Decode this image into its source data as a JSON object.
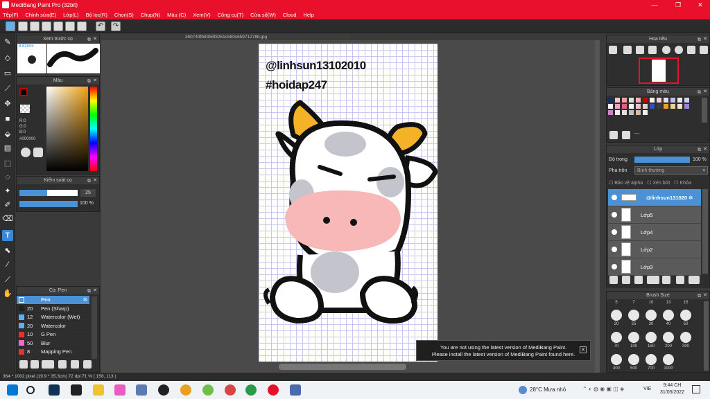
{
  "window": {
    "title": "MediBang Paint Pro (32bit)",
    "minimize": "—",
    "maximize": "❐",
    "close": "✕"
  },
  "menu": [
    "Tệp(F)",
    "Chỉnh sửa(E)",
    "Lớp(L)",
    "Bộ lọc(R)",
    "Chọn(S)",
    "Chụp(N)",
    "Màu (C)",
    "Xem(V)",
    "Công cụ(T)",
    "Cửa sổ(W)",
    "Cloud",
    "Help"
  ],
  "document": {
    "tab": "380743fb9358f3261c580c65971278b.jpg",
    "line1": "@linhsun13102010",
    "line2": "#hoidap247"
  },
  "preview": {
    "title": "Xem trước cọ",
    "size": "8.82mm"
  },
  "color": {
    "title": "Màu",
    "r": "R:0",
    "g": "G:0",
    "b": "B:0",
    "hex": "#000000",
    "primary": "#c00000",
    "secondary": "#ffffff"
  },
  "brush_control": {
    "title": "Kiểm soát cọ",
    "size": "25",
    "opacity": "100 %"
  },
  "brush_list": {
    "title": "Cọ: Pen",
    "items": [
      {
        "size": "",
        "name": "Pen",
        "color": "#4b91d6"
      },
      {
        "size": "20",
        "name": "Pen (Sharp)",
        "color": "#222222"
      },
      {
        "size": "12",
        "name": "Watercolor (Wet)",
        "color": "#5ab0ff"
      },
      {
        "size": "20",
        "name": "Watercolor",
        "color": "#5ab0ff"
      },
      {
        "size": "10",
        "name": "G Pen",
        "color": "#e83030"
      },
      {
        "size": "50",
        "name": "Blur",
        "color": "#ff66cc"
      },
      {
        "size": "8",
        "name": "Mapping Pen",
        "color": "#e83030"
      }
    ]
  },
  "navigator": {
    "title": "Hoa tiêu"
  },
  "palette": {
    "title": "Bảng màu",
    "dash": "---"
  },
  "layers": {
    "title": "Lớp",
    "opacity_label": "Độ trong",
    "opacity": "100 %",
    "blend_label": "Pha trộn",
    "blend": "Bình thường",
    "protect_alpha": "Bảo vệ alpha",
    "clip": "Xén bớt",
    "lock": "Khóa",
    "items": [
      {
        "name": "@linhsun131020"
      },
      {
        "name": "Lớp5"
      },
      {
        "name": "Lớp4"
      },
      {
        "name": "Lớp2"
      },
      {
        "name": "Lớp3"
      }
    ]
  },
  "brush_size": {
    "title": "Brush Size",
    "top": [
      "5",
      "7",
      "10",
      "13",
      "15"
    ],
    "rows": [
      [
        "20",
        "25",
        "30",
        "40",
        "50"
      ],
      [
        "70",
        "100",
        "150",
        "200",
        "300"
      ],
      [
        "400",
        "500",
        "700",
        "1000"
      ]
    ]
  },
  "notice": {
    "line1": "You are not using the latest version of MediBang Paint.",
    "line2": "Please install the latest version of MediBang Paint found here.",
    "close": "✕"
  },
  "status": {
    "text": "364 * 1002 pixel   (19.9 * 35.3cm)   72 dpi   71 %   ( 156, 113 )"
  },
  "taskbar": {
    "weather": "28°C  Mưa nhỏ",
    "lang": "VIE",
    "time": "9:44 CH",
    "date": "31/05/2022"
  }
}
